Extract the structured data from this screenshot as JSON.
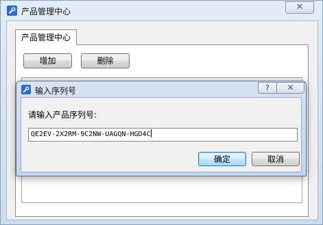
{
  "main_window": {
    "title": "产品管理中心",
    "close_glyph": "✕",
    "tab_label": "产品管理中心",
    "add_button": "增加",
    "delete_button": "删除"
  },
  "dialog": {
    "title": "输入序列号",
    "help_glyph": "?",
    "close_glyph": "✕",
    "prompt": "请输入产品序列号:",
    "serial_value": "QE2EV-2X2RM-9C2NW-UAGQN-HGD4C",
    "ok_button": "确定",
    "cancel_button": "取消"
  },
  "icons": {
    "app_icon": "wrench-icon",
    "dialog_icon": "wrench-icon"
  },
  "colors": {
    "icon_blue": "#2f6cc8",
    "default_button_border": "#3c7fb1"
  }
}
